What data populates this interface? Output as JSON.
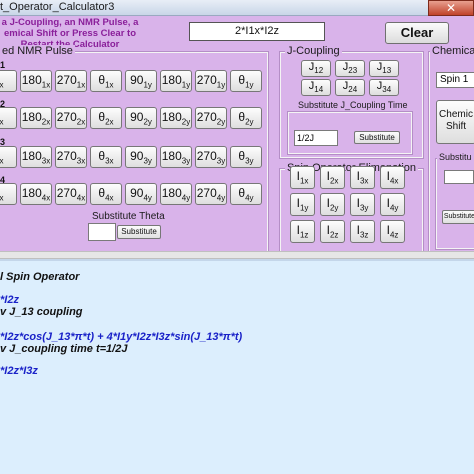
{
  "window": {
    "title": "t_Operator_Calculator3",
    "close_glyph": "✕"
  },
  "header": {
    "instructions": [
      "a J-Coupling, an NMR Pulse, a",
      "emical Shift or Press Clear to",
      "Restart the Calculator"
    ],
    "expression": "2*I1x*I2z",
    "clear_label": "Clear"
  },
  "nmr_pulse": {
    "title": "ed NMR Pulse",
    "rows": [
      {
        "label": "1",
        "buttons": [
          [
            "",
            "x"
          ],
          [
            "180",
            "1x"
          ],
          [
            "270",
            "1x"
          ],
          [
            "θ",
            "1x"
          ],
          [
            "90",
            "1y"
          ],
          [
            "180",
            "1y"
          ],
          [
            "270",
            "1y"
          ],
          [
            "θ",
            "1y"
          ]
        ]
      },
      {
        "label": "2",
        "buttons": [
          [
            "",
            "x"
          ],
          [
            "180",
            "2x"
          ],
          [
            "270",
            "2x"
          ],
          [
            "θ",
            "2x"
          ],
          [
            "90",
            "2y"
          ],
          [
            "180",
            "2y"
          ],
          [
            "270",
            "2y"
          ],
          [
            "θ",
            "2y"
          ]
        ]
      },
      {
        "label": "3",
        "buttons": [
          [
            "",
            "x"
          ],
          [
            "180",
            "3x"
          ],
          [
            "270",
            "3x"
          ],
          [
            "θ",
            "3x"
          ],
          [
            "90",
            "3y"
          ],
          [
            "180",
            "3y"
          ],
          [
            "270",
            "3y"
          ],
          [
            "θ",
            "3y"
          ]
        ]
      },
      {
        "label": "4",
        "buttons": [
          [
            "",
            "x"
          ],
          [
            "180",
            "4x"
          ],
          [
            "270",
            "4x"
          ],
          [
            "θ",
            "4x"
          ],
          [
            "90",
            "4y"
          ],
          [
            "180",
            "4y"
          ],
          [
            "270",
            "4y"
          ],
          [
            "θ",
            "4y"
          ]
        ]
      }
    ],
    "theta_label": "Substitute Theta",
    "theta_value": "",
    "theta_button": "Substitute"
  },
  "j_coupling": {
    "title": "J-Coupling",
    "buttons": [
      [
        "J",
        "12"
      ],
      [
        "J",
        "23"
      ],
      [
        "J",
        "13"
      ],
      [
        "J",
        "14"
      ],
      [
        "J",
        "24"
      ],
      [
        "J",
        "34"
      ]
    ],
    "time_label": "Substitute J_Coupling Time",
    "time_value": "1/2J",
    "time_button": "Substitute"
  },
  "spin_elim": {
    "title": "Spin Operator Elimenation",
    "buttons": [
      [
        "I",
        "1x"
      ],
      [
        "I",
        "2x"
      ],
      [
        "I",
        "3x"
      ],
      [
        "I",
        "4x"
      ],
      [
        "I",
        "1y"
      ],
      [
        "I",
        "2y"
      ],
      [
        "I",
        "3y"
      ],
      [
        "I",
        "4y"
      ],
      [
        "I",
        "1z"
      ],
      [
        "I",
        "2z"
      ],
      [
        "I",
        "3z"
      ],
      [
        "I",
        "4z"
      ]
    ]
  },
  "chemical_shift": {
    "title": "Chemica",
    "spin_select": "Spin 1",
    "button_line1": "Chemic",
    "button_line2": "Shift",
    "substitute_label": "Substitu",
    "substitute_value": "",
    "substitute_button": "Substitute"
  },
  "output": {
    "lines": [
      {
        "text": "l Spin Operator",
        "color": "black"
      },
      {
        "text": "*I2z",
        "color": "blue"
      },
      {
        "text": "v J_13 coupling",
        "color": "black"
      },
      {
        "text": "*I2z*cos(J_13*π*t) + 4*I1y*I2z*I3z*sin(J_13*π*t)",
        "color": "blue"
      },
      {
        "text": "v J_coupling time t=1/2J",
        "color": "black"
      },
      {
        "text": "*I2z*I3z",
        "color": "blue"
      }
    ]
  }
}
